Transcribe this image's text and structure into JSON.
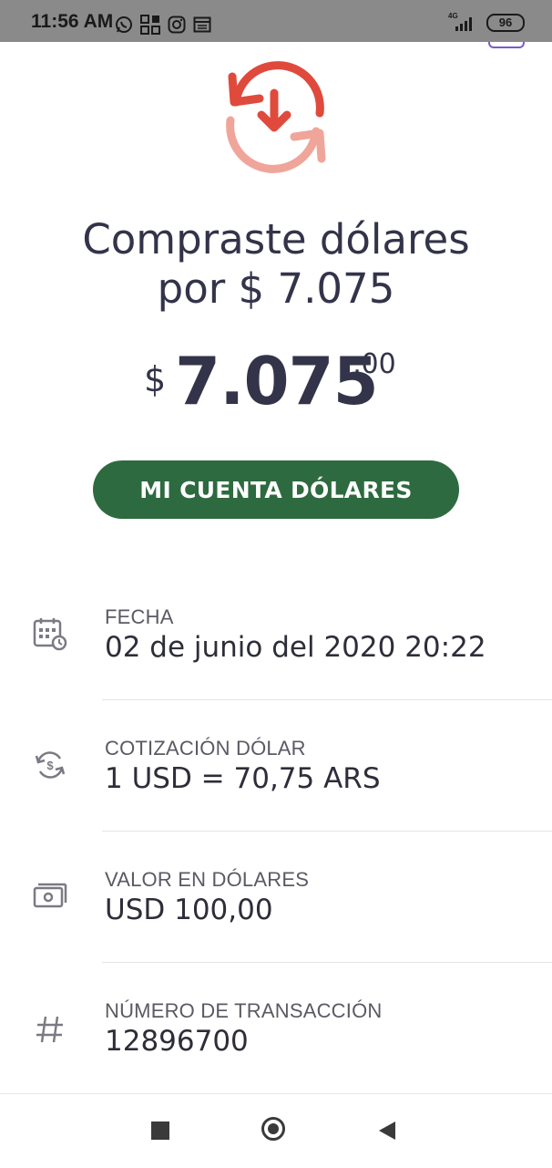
{
  "status_bar": {
    "time": "11:56 AM",
    "network": "4G",
    "battery": "96"
  },
  "colors": {
    "accent_green": "#2d6a3f",
    "icon_red": "#e04a3c",
    "icon_pink": "#f0a59a",
    "text_dark": "#33344a"
  },
  "header": {
    "icon": "currency-exchange-icon",
    "title_line1": "Compraste dólares",
    "title_line2": "por $ 7.075"
  },
  "amount": {
    "currency": "$",
    "integer": "7.075",
    "decimals": ",00"
  },
  "cta": {
    "label": "MI CUENTA DÓLARES"
  },
  "details": [
    {
      "icon": "calendar-clock-icon",
      "label": "FECHA",
      "value": "02 de junio del 2020 20:22"
    },
    {
      "icon": "exchange-rate-icon",
      "label": "COTIZACIÓN DÓLAR",
      "value": "1 USD = 70,75 ARS"
    },
    {
      "icon": "money-bill-icon",
      "label": "VALOR EN DÓLARES",
      "value": "USD 100,00"
    },
    {
      "icon": "hash-icon",
      "label": "NÚMERO DE TRANSACCIÓN",
      "value": "12896700"
    }
  ],
  "nav": {
    "recent": "recent-apps-icon",
    "home": "home-icon",
    "back": "back-icon"
  }
}
